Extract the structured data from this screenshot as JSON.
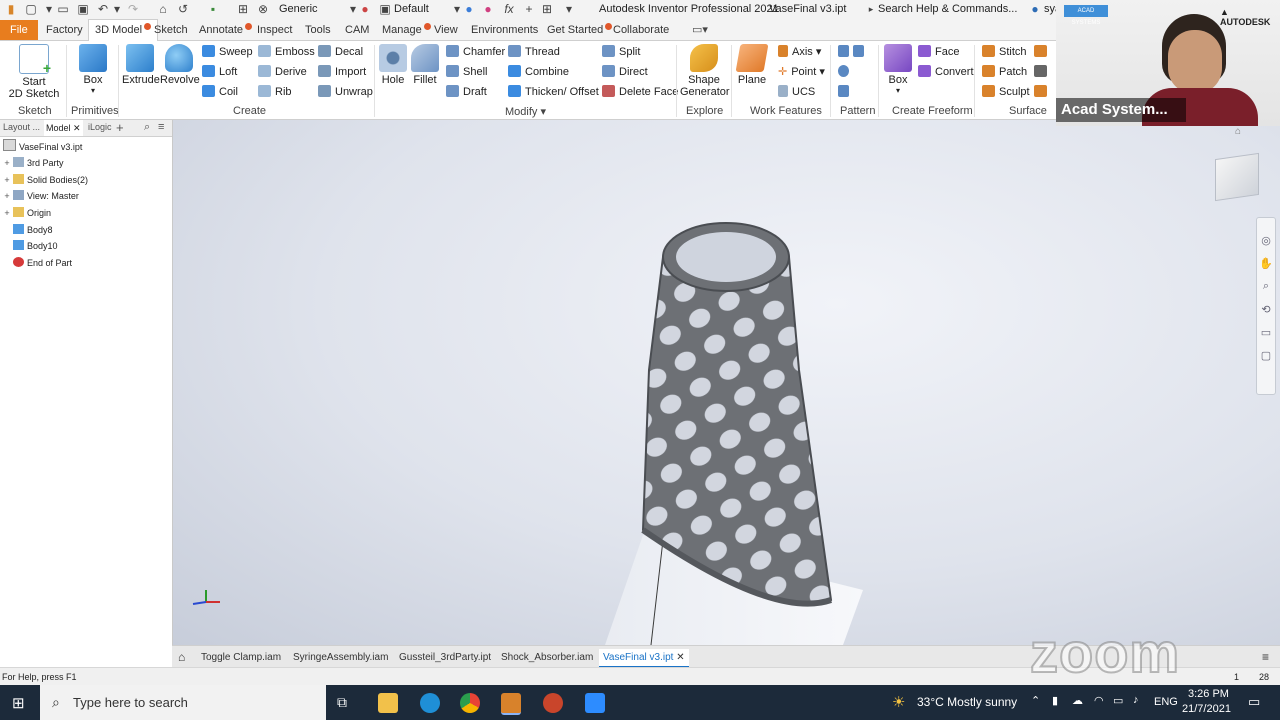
{
  "title_bar": {
    "app_title": "Autodesk Inventor Professional 2021",
    "doc_title": "VaseFinal v3.ipt",
    "search_placeholder": "Search Help & Commands...",
    "user": "sya",
    "appearance": "Generic",
    "design_view": "Default"
  },
  "tabs": [
    "File",
    "Factory",
    "3D Model",
    "Sketch",
    "Annotate",
    "Inspect",
    "Tools",
    "CAM",
    "Manage",
    "View",
    "Environments",
    "Get Started",
    "Collaborate"
  ],
  "ribbon": {
    "sketch": {
      "start_line1": "Start",
      "start_line2": "2D Sketch",
      "panel": "Sketch"
    },
    "primitives": {
      "box": "Box",
      "panel": "Primitives"
    },
    "create": {
      "extrude": "Extrude",
      "revolve": "Revolve",
      "sweep": "Sweep",
      "loft": "Loft",
      "coil": "Coil",
      "emboss": "Emboss",
      "derive": "Derive",
      "rib": "Rib",
      "decal": "Decal",
      "import": "Import",
      "unwrap": "Unwrap",
      "panel": "Create"
    },
    "modify": {
      "hole": "Hole",
      "fillet": "Fillet",
      "chamfer": "Chamfer",
      "shell": "Shell",
      "draft": "Draft",
      "thread": "Thread",
      "combine": "Combine",
      "thicken": "Thicken/ Offset",
      "split": "Split",
      "direct": "Direct",
      "delete_face": "Delete Face",
      "panel": "Modify"
    },
    "explore": {
      "shape_gen_line1": "Shape",
      "shape_gen_line2": "Generator",
      "panel": "Explore"
    },
    "work_features": {
      "plane": "Plane",
      "axis": "Axis",
      "point": "Point",
      "ucs": "UCS",
      "panel": "Work Features"
    },
    "pattern": {
      "panel": "Pattern"
    },
    "freeform": {
      "box": "Box",
      "face": "Face",
      "convert": "Convert",
      "panel": "Create Freeform"
    },
    "surface": {
      "stitch": "Stitch",
      "patch": "Patch",
      "sculpt": "Sculpt",
      "panel": "Surface"
    }
  },
  "browser": {
    "tabs": [
      "Layout ...",
      "Model",
      "iLogic"
    ],
    "items": [
      {
        "label": "VaseFinal v3.ipt",
        "icon": "part-icon"
      },
      {
        "label": "3rd Party",
        "icon": "third-party-icon"
      },
      {
        "label": "Solid Bodies(2)",
        "icon": "folder-icon"
      },
      {
        "label": "View: Master",
        "icon": "view-icon"
      },
      {
        "label": "Origin",
        "icon": "folder-icon"
      },
      {
        "label": "Body8",
        "icon": "body-icon"
      },
      {
        "label": "Body10",
        "icon": "body-icon"
      },
      {
        "label": "End of Part",
        "icon": "end-of-part-icon"
      }
    ]
  },
  "doc_tabs": [
    "Toggle Clamp.iam",
    "SyringeAssembly.iam",
    "Gussteil_3rdParty.ipt",
    "Shock_Absorber.iam",
    "VaseFinal v3.ipt"
  ],
  "status": {
    "help": "For Help, press F1",
    "count1": "1",
    "count2": "28"
  },
  "taskbar": {
    "search_placeholder": "Type here to search",
    "weather": "33°C  Mostly sunny",
    "lang": "ENG",
    "time": "3:26 PM",
    "date": "21/7/2021"
  },
  "webcam": {
    "name": "Acad System...",
    "brand": "AUTODESK",
    "logo_text": "ACAD SYSTEMS"
  },
  "zoom_watermark": "zoom",
  "colors": {
    "file_tab": "#e87d1e",
    "accent": "#1a73c7",
    "taskbar": "#1c2a3a"
  }
}
